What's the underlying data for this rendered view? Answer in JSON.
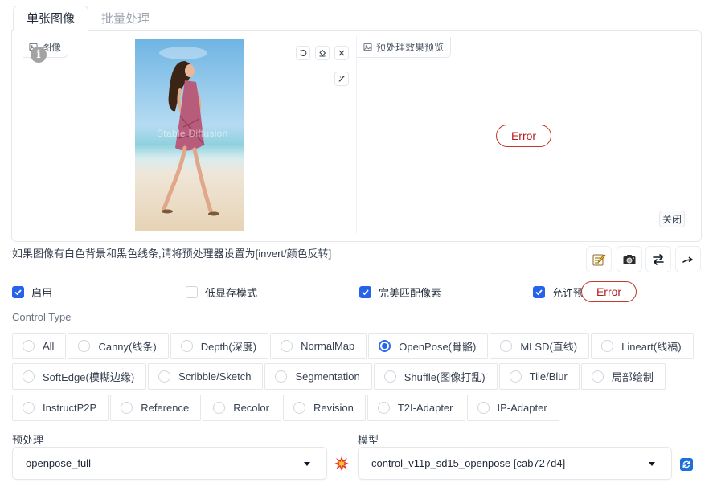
{
  "tabs": [
    {
      "label": "单张图像",
      "active": true
    },
    {
      "label": "批量处理",
      "active": false
    }
  ],
  "image_panel": {
    "label": "图像",
    "watermark": "Stable Diffusion",
    "icons": [
      "rotate-icon",
      "eraser-icon",
      "close-icon",
      "brush-icon"
    ]
  },
  "preview_panel": {
    "label": "预处理效果预览",
    "error": "Error",
    "close_label": "关闭"
  },
  "hint": "如果图像有白色背景和黑色线条,请将预处理器设置为[invert/颜色反转]",
  "toolbar_icons": [
    "notepad-icon",
    "camera-icon",
    "swap-icon",
    "send-icon"
  ],
  "checkboxes": [
    {
      "label": "启用",
      "checked": true
    },
    {
      "label": "低显存模式",
      "checked": false
    },
    {
      "label": "完美匹配像素",
      "checked": true
    },
    {
      "label": "允许预",
      "checked": true
    }
  ],
  "checkbox_error": "Error",
  "control_type": {
    "label": "Control Type",
    "rows": [
      [
        {
          "label": "All",
          "selected": false
        },
        {
          "label": "Canny(线条)",
          "selected": false
        },
        {
          "label": "Depth(深度)",
          "selected": false
        },
        {
          "label": "NormalMap",
          "selected": false
        },
        {
          "label": "OpenPose(骨骼)",
          "selected": true
        },
        {
          "label": "MLSD(直线)",
          "selected": false
        },
        {
          "label": "Lineart(线稿)",
          "selected": false
        }
      ],
      [
        {
          "label": "SoftEdge(模糊边缘)",
          "selected": false
        },
        {
          "label": "Scribble/Sketch",
          "selected": false
        },
        {
          "label": "Segmentation",
          "selected": false
        },
        {
          "label": "Shuffle(图像打乱)",
          "selected": false
        },
        {
          "label": "Tile/Blur",
          "selected": false
        },
        {
          "label": "局部绘制",
          "selected": false
        }
      ],
      [
        {
          "label": "InstructP2P",
          "selected": false
        },
        {
          "label": "Reference",
          "selected": false
        },
        {
          "label": "Recolor",
          "selected": false
        },
        {
          "label": "Revision",
          "selected": false
        },
        {
          "label": "T2I-Adapter",
          "selected": false
        },
        {
          "label": "IP-Adapter",
          "selected": false
        }
      ]
    ]
  },
  "preprocessor": {
    "label": "预处理",
    "value": "openpose_full"
  },
  "model": {
    "label": "模型",
    "value": "control_v11p_sd15_openpose [cab727d4]"
  },
  "colors": {
    "accent": "#2563eb",
    "error": "#b91c1c",
    "border": "#e5e7eb"
  }
}
